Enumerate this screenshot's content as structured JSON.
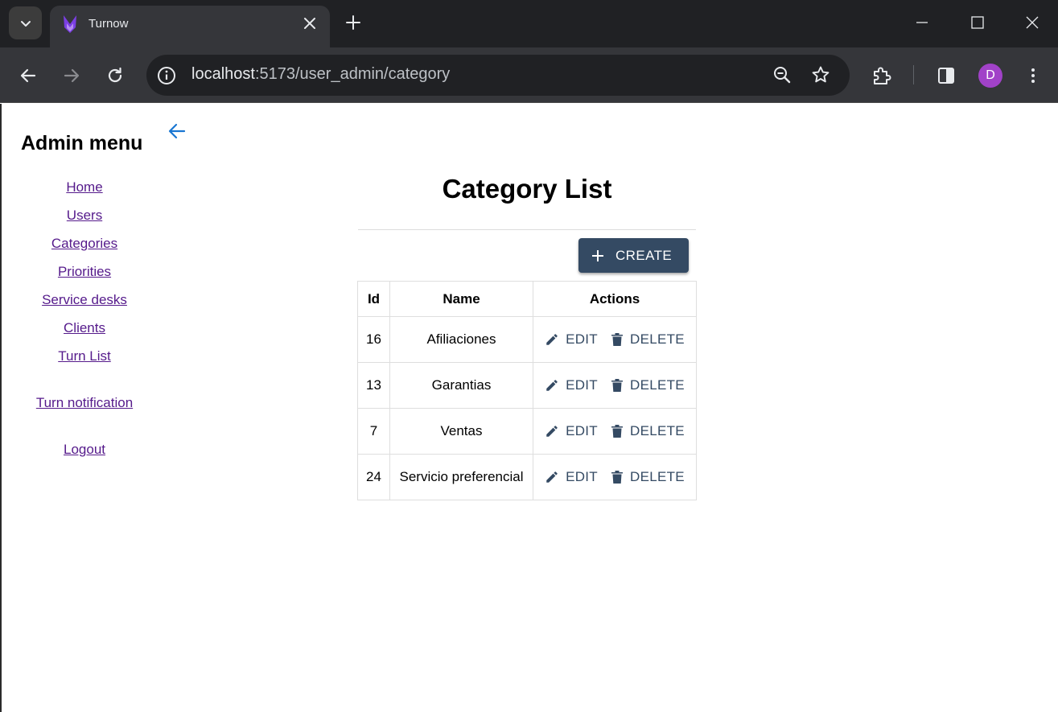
{
  "browser": {
    "tab_title": "Turnow",
    "url_host": "localhost",
    "url_rest": ":5173/user_admin/category",
    "avatar_initial": "D"
  },
  "sidebar": {
    "title": "Admin menu",
    "items": [
      {
        "label": "Home"
      },
      {
        "label": "Users"
      },
      {
        "label": "Categories"
      },
      {
        "label": "Priorities"
      },
      {
        "label": "Service desks"
      },
      {
        "label": "Clients"
      },
      {
        "label": "Turn List"
      },
      {
        "label": "Turn notification"
      },
      {
        "label": "Logout"
      }
    ]
  },
  "main": {
    "title": "Category List",
    "create_label": "CREATE",
    "table": {
      "headers": [
        "Id",
        "Name",
        "Actions"
      ],
      "edit_label": "EDIT",
      "delete_label": "DELETE",
      "rows": [
        {
          "id": "16",
          "name": "Afiliaciones"
        },
        {
          "id": "13",
          "name": "Garantias"
        },
        {
          "id": "7",
          "name": "Ventas"
        },
        {
          "id": "24",
          "name": "Servicio preferencial"
        }
      ]
    }
  },
  "colors": {
    "primary": "#344a63",
    "link": "#551a8b",
    "back_arrow": "#1976d2",
    "avatar": "#a142c8"
  }
}
